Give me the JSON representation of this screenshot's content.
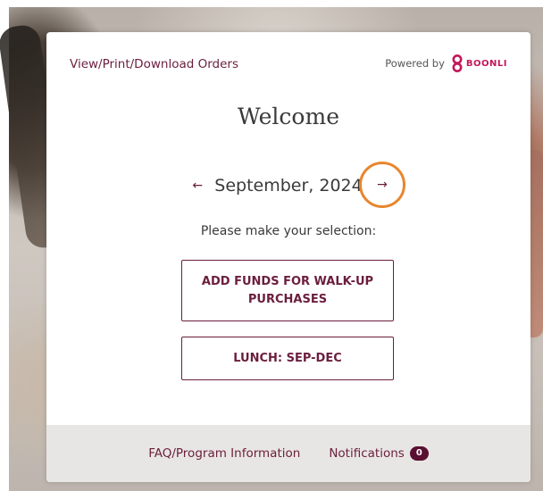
{
  "header": {
    "orders_link": "View/Print/Download Orders",
    "powered_by": "Powered by",
    "brand": "BOONLI",
    "brand_color": "#c2185b"
  },
  "welcome": {
    "title": "Welcome"
  },
  "month_nav": {
    "prev_icon": "arrow-left-icon",
    "prev_glyph": "←",
    "label": "September, 2024",
    "next_icon": "arrow-right-icon",
    "next_glyph": "→",
    "highlight_color": "#e8862e"
  },
  "selection": {
    "prompt": "Please make your selection:",
    "options": [
      {
        "label": "ADD FUNDS FOR WALK-UP PURCHASES"
      },
      {
        "label": "LUNCH: SEP-DEC"
      }
    ]
  },
  "footer": {
    "faq_link": "FAQ/Program Information",
    "notifications_label": "Notifications",
    "notifications_count": "0"
  },
  "colors": {
    "accent": "#6b1e3d",
    "footer_bg": "#e8e6e4"
  }
}
